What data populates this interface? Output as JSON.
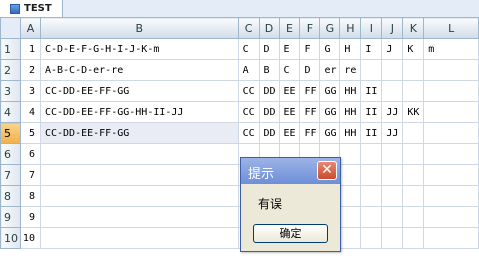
{
  "sheet_tab": {
    "label": "TEST"
  },
  "columns": [
    "A",
    "B",
    "C",
    "D",
    "E",
    "F",
    "G",
    "H",
    "I",
    "J",
    "K",
    "L"
  ],
  "rows": [
    {
      "num": "1",
      "a": "1",
      "b": "C-D-E-F-G-H-I-J-K-m",
      "cells": [
        "C",
        "D",
        "E",
        "F",
        "G",
        "H",
        "I",
        "J",
        "K",
        "m"
      ]
    },
    {
      "num": "2",
      "a": "2",
      "b": "A-B-C-D-er-re",
      "cells": [
        "A",
        "B",
        "C",
        "D",
        "er",
        "re",
        "",
        "",
        "",
        ""
      ]
    },
    {
      "num": "3",
      "a": "3",
      "b": "CC-DD-EE-FF-GG",
      "cells": [
        "CC",
        "DD",
        "EE",
        "FF",
        "GG",
        "HH",
        "II",
        "",
        "",
        ""
      ]
    },
    {
      "num": "4",
      "a": "4",
      "b": "CC-DD-EE-FF-GG-HH-II-JJ",
      "cells": [
        "CC",
        "DD",
        "EE",
        "FF",
        "GG",
        "HH",
        "II",
        "JJ",
        "KK",
        ""
      ]
    },
    {
      "num": "5",
      "a": "5",
      "b": "CC-DD-EE-FF-GG",
      "cells": [
        "CC",
        "DD",
        "EE",
        "FF",
        "GG",
        "HH",
        "II",
        "JJ",
        "",
        ""
      ]
    },
    {
      "num": "6",
      "a": "6",
      "b": "",
      "cells": [
        "",
        "",
        "",
        "",
        "",
        "",
        "",
        "",
        "",
        ""
      ]
    },
    {
      "num": "7",
      "a": "7",
      "b": "",
      "cells": [
        "",
        "",
        "",
        "",
        "",
        "",
        "",
        "",
        "",
        ""
      ]
    },
    {
      "num": "8",
      "a": "8",
      "b": "",
      "cells": [
        "",
        "",
        "",
        "",
        "",
        "",
        "",
        "",
        "",
        ""
      ]
    },
    {
      "num": "9",
      "a": "9",
      "b": "",
      "cells": [
        "",
        "",
        "",
        "",
        "",
        "",
        "",
        "",
        "",
        ""
      ]
    },
    {
      "num": "10",
      "a": "10",
      "b": "",
      "cells": [
        "",
        "",
        "",
        "",
        "",
        "",
        "",
        "",
        "",
        ""
      ]
    }
  ],
  "active_row": "5",
  "dialog": {
    "title": "提示",
    "message": "有误",
    "ok_label": "确定",
    "close_glyph": "✕"
  },
  "colors": {
    "active_row_header": "#f2b04a",
    "header_bg": "#d3dbe9",
    "dialog_title": "#6d8fd8"
  }
}
